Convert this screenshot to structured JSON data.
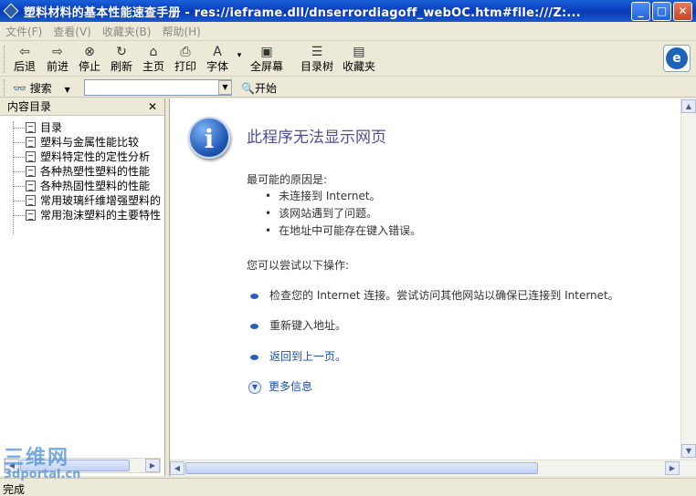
{
  "window": {
    "title": "塑料材料的基本性能速查手册 - res://ieframe.dll/dnserrordiagoff_webOC.htm#file:///Z:...",
    "minimize_glyph": "_",
    "maximize_glyph": "□",
    "close_glyph": "✕"
  },
  "menu": [
    "文件(F)",
    "查看(V)",
    "收藏夹(B)",
    "帮助(H)"
  ],
  "toolbar": {
    "buttons": [
      {
        "label": "后退",
        "icon": "back-arrow-icon",
        "glyph": "⇦"
      },
      {
        "label": "前进",
        "icon": "forward-arrow-icon",
        "glyph": "⇨"
      },
      {
        "label": "停止",
        "icon": "stop-icon",
        "glyph": "⊗"
      },
      {
        "label": "刷新",
        "icon": "refresh-icon",
        "glyph": "↻"
      },
      {
        "label": "主页",
        "icon": "home-icon",
        "glyph": "⌂"
      },
      {
        "label": "打印",
        "icon": "print-icon",
        "glyph": "⎙"
      },
      {
        "label": "字体",
        "icon": "font-icon",
        "glyph": "A"
      },
      {
        "label": "全屏幕",
        "icon": "fullscreen-icon",
        "glyph": "▣"
      },
      {
        "label": "目录树",
        "icon": "tree-icon",
        "glyph": "☰"
      },
      {
        "label": "收藏夹",
        "icon": "favorites-icon",
        "glyph": "▤"
      }
    ],
    "font_dropdown_glyph": "▾",
    "logo_glyph": "e"
  },
  "search": {
    "label": "搜索",
    "input_value": "",
    "start_label": "开始"
  },
  "contents_pane": {
    "title": "内容目录",
    "close_glyph": "✕",
    "items": [
      "目录",
      "塑料与金属性能比较",
      "塑料特定性的定性分析",
      "各种热塑性塑料的性能",
      "各种热固性塑料的性能",
      "常用玻璃纤维增强塑料的",
      "常用泡沫塑料的主要特性"
    ]
  },
  "error_page": {
    "title": "此程序无法显示网页",
    "reasons_heading": "最可能的原因是:",
    "reasons": [
      "未连接到 Internet。",
      "该网站遇到了问题。",
      "在地址中可能存在键入错误。"
    ],
    "try_heading": "您可以尝试以下操作:",
    "actions": [
      "检查您的 Internet 连接。尝试访问其他网站以确保已连接到 Internet。",
      "重新键入地址。",
      "返回到上一页。"
    ],
    "more_info": "更多信息"
  },
  "status": {
    "text": "完成"
  },
  "watermark": {
    "line1": "三维网",
    "line2": "3dportal.cn"
  },
  "colors": {
    "title_bar": "#0a3fc0",
    "error_title": "#4e4e9b",
    "link": "#1a4fa8",
    "watermark": "#4b8fd8"
  }
}
